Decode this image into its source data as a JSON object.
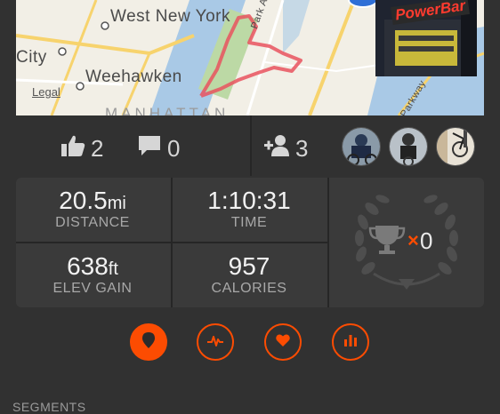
{
  "map": {
    "labels": {
      "west_new_york": "West New York",
      "city": "City",
      "weehawken": "Weehawken",
      "manhattan": "MANHATTAN",
      "park_ave": "Park Ave",
      "parkway": "Parkway"
    },
    "legal": "Legal",
    "photo_brand": "PowerBar"
  },
  "social": {
    "kudos_count": "2",
    "comment_count": "0",
    "athletes_count": "3",
    "avatars": [
      "athlete-1",
      "athlete-2",
      "athlete-3"
    ]
  },
  "stats": {
    "distance": {
      "value": "20.5",
      "unit": "mi",
      "label": "DISTANCE"
    },
    "time": {
      "value": "1:10:31",
      "label": "TIME"
    },
    "elevation": {
      "value": "638",
      "unit": "ft",
      "label": "ELEV GAIN"
    },
    "calories": {
      "value": "957",
      "label": "CALORIES"
    },
    "achievements": {
      "multiplier": "×",
      "count": "0"
    }
  },
  "actions": [
    {
      "name": "map-tab",
      "icon": "map-pin-icon",
      "active": true
    },
    {
      "name": "analysis-tab",
      "icon": "pulse-icon",
      "active": false
    },
    {
      "name": "heart-rate-tab",
      "icon": "heart-icon",
      "active": false
    },
    {
      "name": "splits-tab",
      "icon": "bar-chart-icon",
      "active": false
    }
  ],
  "sections": {
    "segments": "SEGMENTS"
  },
  "colors": {
    "accent": "#fc4c02",
    "background": "#313131",
    "panel": "#3a3a3a"
  }
}
